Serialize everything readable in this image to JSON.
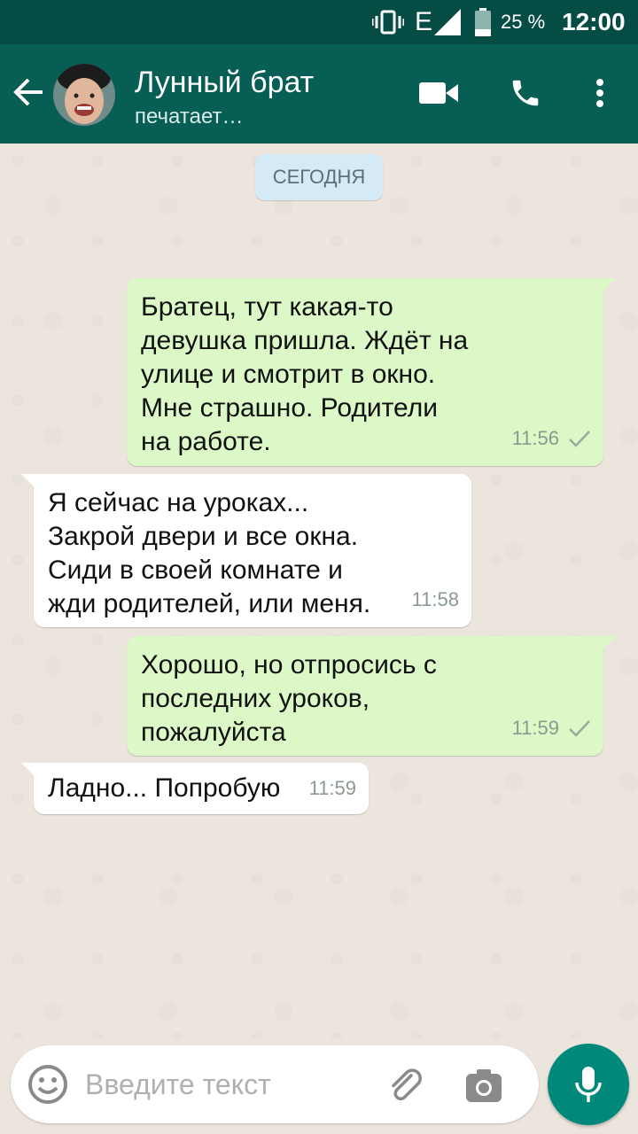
{
  "status_bar": {
    "network": "E",
    "battery": "25 %",
    "time": "12:00"
  },
  "header": {
    "contact_name": "Лунный брат",
    "contact_status": "печатает…"
  },
  "chat": {
    "date_label": "СЕГОДНЯ",
    "messages": [
      {
        "direction": "out",
        "text": "Братец, тут какая-то\nдевушка пришла. Ждёт на\nулице и смотрит в окно.\nМне страшно. Родители\nна работе.",
        "time": "11:56"
      },
      {
        "direction": "in",
        "text": "Я сейчас на уроках...\nЗакрой двери и все окна.\nСиди в своей комнате и\nжди родителей, или меня.",
        "time": "11:58"
      },
      {
        "direction": "out",
        "text": "Хорошо, но отпросись с\nпоследних уроков,\nпожалуйста",
        "time": "11:59"
      },
      {
        "direction": "in",
        "text": "Ладно... Попробую",
        "time": "11:59"
      }
    ]
  },
  "composer": {
    "placeholder": "Введите текст"
  },
  "colors": {
    "header": "#075e54",
    "status_bar": "#054d44",
    "outgoing_bubble": "#dcf8c6",
    "incoming_bubble": "#ffffff",
    "mic_button": "#00897b"
  }
}
